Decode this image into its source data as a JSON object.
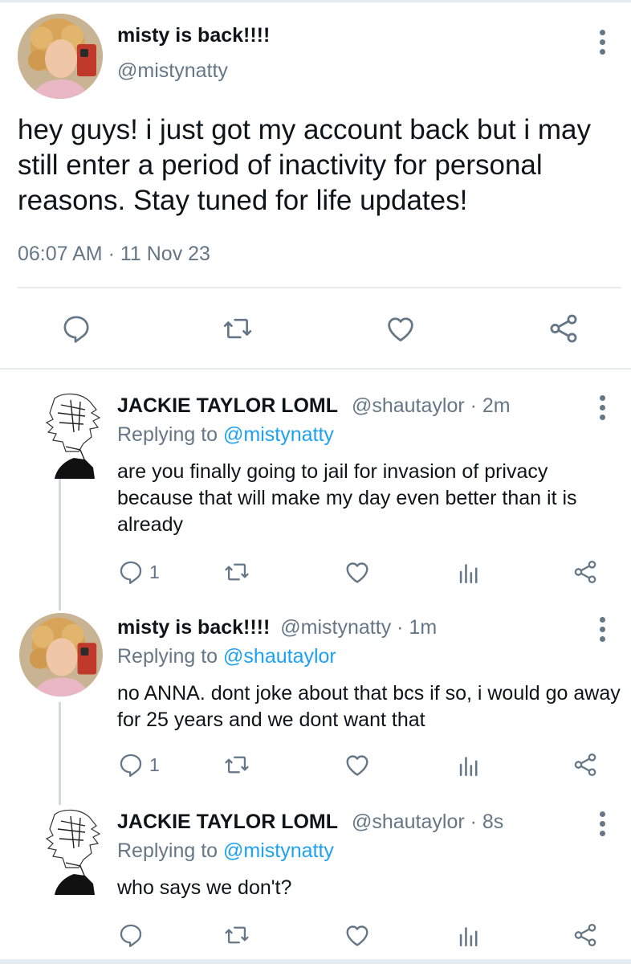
{
  "main_tweet": {
    "display_name": "misty is back!!!!",
    "handle": "@mistynatty",
    "text": "hey guys! i just got my account back but i may still enter a period of inactivity for personal reasons. Stay tuned for life updates!",
    "timestamp": "06:07 AM · 11 Nov 23",
    "actions": [
      "reply-icon",
      "retweet-icon",
      "like-icon",
      "share-icon"
    ]
  },
  "replies": [
    {
      "display_name": "JACKIE TAYLOR LOML",
      "meta": "@shautaylor · 2m",
      "replying_prefix": "Replying to",
      "replying_to": "@mistynatty",
      "text": "are you finally going to jail for invasion of privacy because that will make my day even better than it is already",
      "reply_count": "1"
    },
    {
      "display_name": "misty is back!!!!",
      "meta": "@mistynatty · 1m",
      "replying_prefix": "Replying to",
      "replying_to": "@shautaylor",
      "text": "no ANNA. dont joke about that bcs if so, i would go away for 25 years and we dont want that",
      "reply_count": "1"
    },
    {
      "display_name": "JACKIE TAYLOR LOML",
      "meta": "@shautaylor · 8s",
      "replying_prefix": "Replying to",
      "replying_to": "@mistynatty",
      "text": "who says we don't?",
      "reply_count": ""
    }
  ],
  "colors": {
    "text": "#0f1419",
    "secondary": "#657786",
    "link": "#1da1f2",
    "divider": "#e6ecf0"
  }
}
